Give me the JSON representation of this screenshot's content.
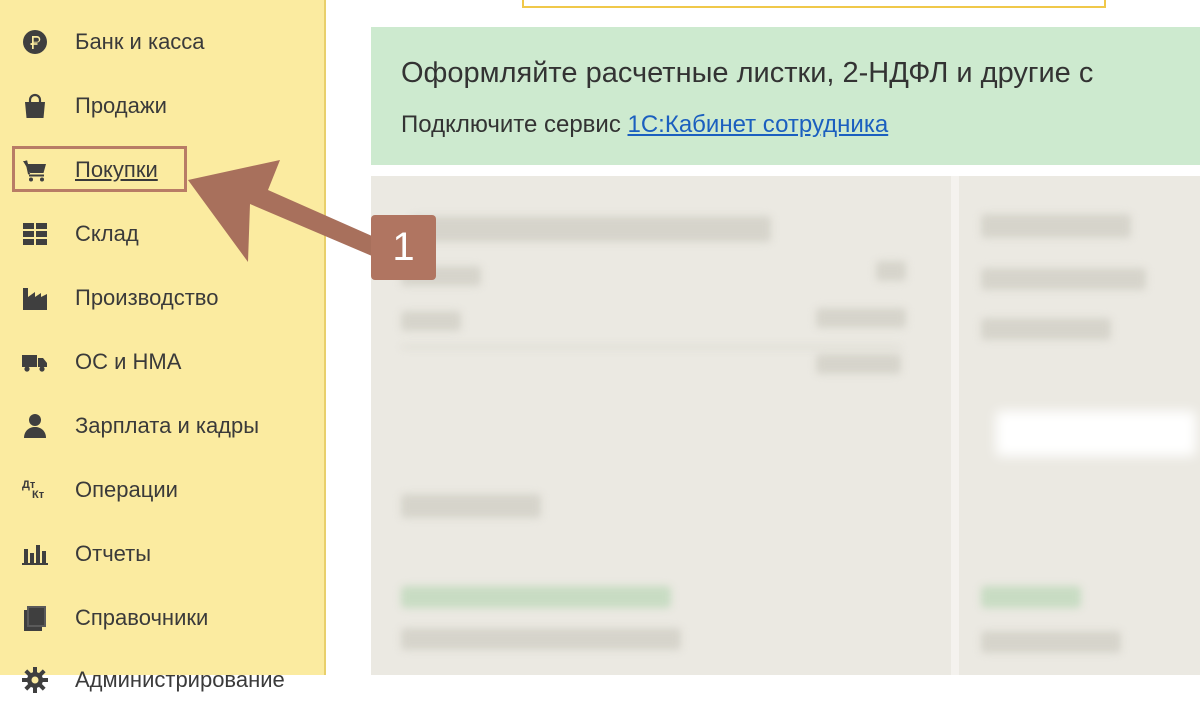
{
  "sidebar": {
    "items": [
      {
        "icon": "ruble-icon",
        "label": "Банк и касса"
      },
      {
        "icon": "shopping-bag-icon",
        "label": "Продажи"
      },
      {
        "icon": "cart-icon",
        "label": "Покупки",
        "active": true
      },
      {
        "icon": "warehouse-grid-icon",
        "label": "Склад"
      },
      {
        "icon": "factory-icon",
        "label": "Производство"
      },
      {
        "icon": "truck-icon",
        "label": "ОС и НМА"
      },
      {
        "icon": "person-icon",
        "label": "Зарплата и кадры"
      },
      {
        "icon": "dt-kt-icon",
        "label": "Операции",
        "icon_text_top": "Дт",
        "icon_text_bottom": "Кт"
      },
      {
        "icon": "bar-chart-icon",
        "label": "Отчеты"
      },
      {
        "icon": "books-icon",
        "label": "Справочники"
      },
      {
        "icon": "gear-icon",
        "label": "Администрирование"
      }
    ]
  },
  "banner": {
    "title": "Оформляйте расчетные листки, 2-НДФЛ и другие с",
    "text": "Подключите сервис",
    "link": "1С:Кабинет сотрудника"
  },
  "annotation": {
    "step": "1"
  },
  "colors": {
    "sidebar_bg": "#fbeba0",
    "banner_bg": "#cdeacf",
    "link": "#1b5fbf",
    "annotation": "#b07561"
  }
}
